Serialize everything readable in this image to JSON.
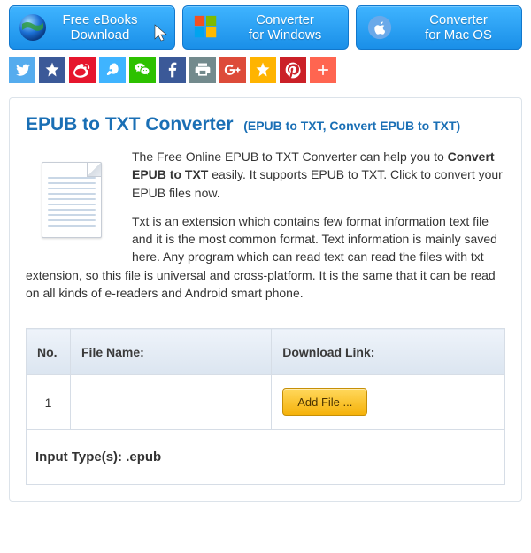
{
  "topButtons": [
    {
      "label": "Free eBooks\nDownload",
      "icon": "globe"
    },
    {
      "label": "Converter\nfor Windows",
      "icon": "windows"
    },
    {
      "label": "Converter\nfor Mac OS",
      "icon": "mac"
    }
  ],
  "shareIcons": [
    {
      "name": "twitter",
      "color": "#55acee"
    },
    {
      "name": "qzone",
      "color": "#3b5998"
    },
    {
      "name": "weibo",
      "color": "#e6162d"
    },
    {
      "name": "tencent",
      "color": "#3fb4ff"
    },
    {
      "name": "wechat",
      "color": "#2dc100"
    },
    {
      "name": "facebook",
      "color": "#3b5998"
    },
    {
      "name": "print",
      "color": "#738a8d"
    },
    {
      "name": "googleplus",
      "color": "#dd4b39"
    },
    {
      "name": "favorite",
      "color": "#ffb400"
    },
    {
      "name": "pinterest",
      "color": "#cb2027"
    },
    {
      "name": "more",
      "color": "#ff6550"
    }
  ],
  "title": {
    "main": "EPUB to TXT Converter",
    "sub": "(EPUB to TXT, Convert EPUB to TXT)"
  },
  "description": {
    "p1_pre": "The Free Online EPUB to TXT Converter can help you to ",
    "p1_strong": "Convert EPUB to TXT",
    "p1_post": " easily. It supports EPUB to TXT. Click to convert your EPUB files now.",
    "p2": "Txt is an extension which contains few format information text file and it is the most common format. Text information is mainly saved here. Any program which can read text can read the files with txt extension, so this file is universal and cross-platform. It is the same that it can be read on all kinds of e-readers and Android smart phone."
  },
  "table": {
    "headers": {
      "no": "No.",
      "filename": "File Name:",
      "download": "Download Link:"
    },
    "rows": [
      {
        "no": "1",
        "filename": "",
        "action": "Add File ..."
      }
    ],
    "footer": "Input Type(s): .epub"
  }
}
